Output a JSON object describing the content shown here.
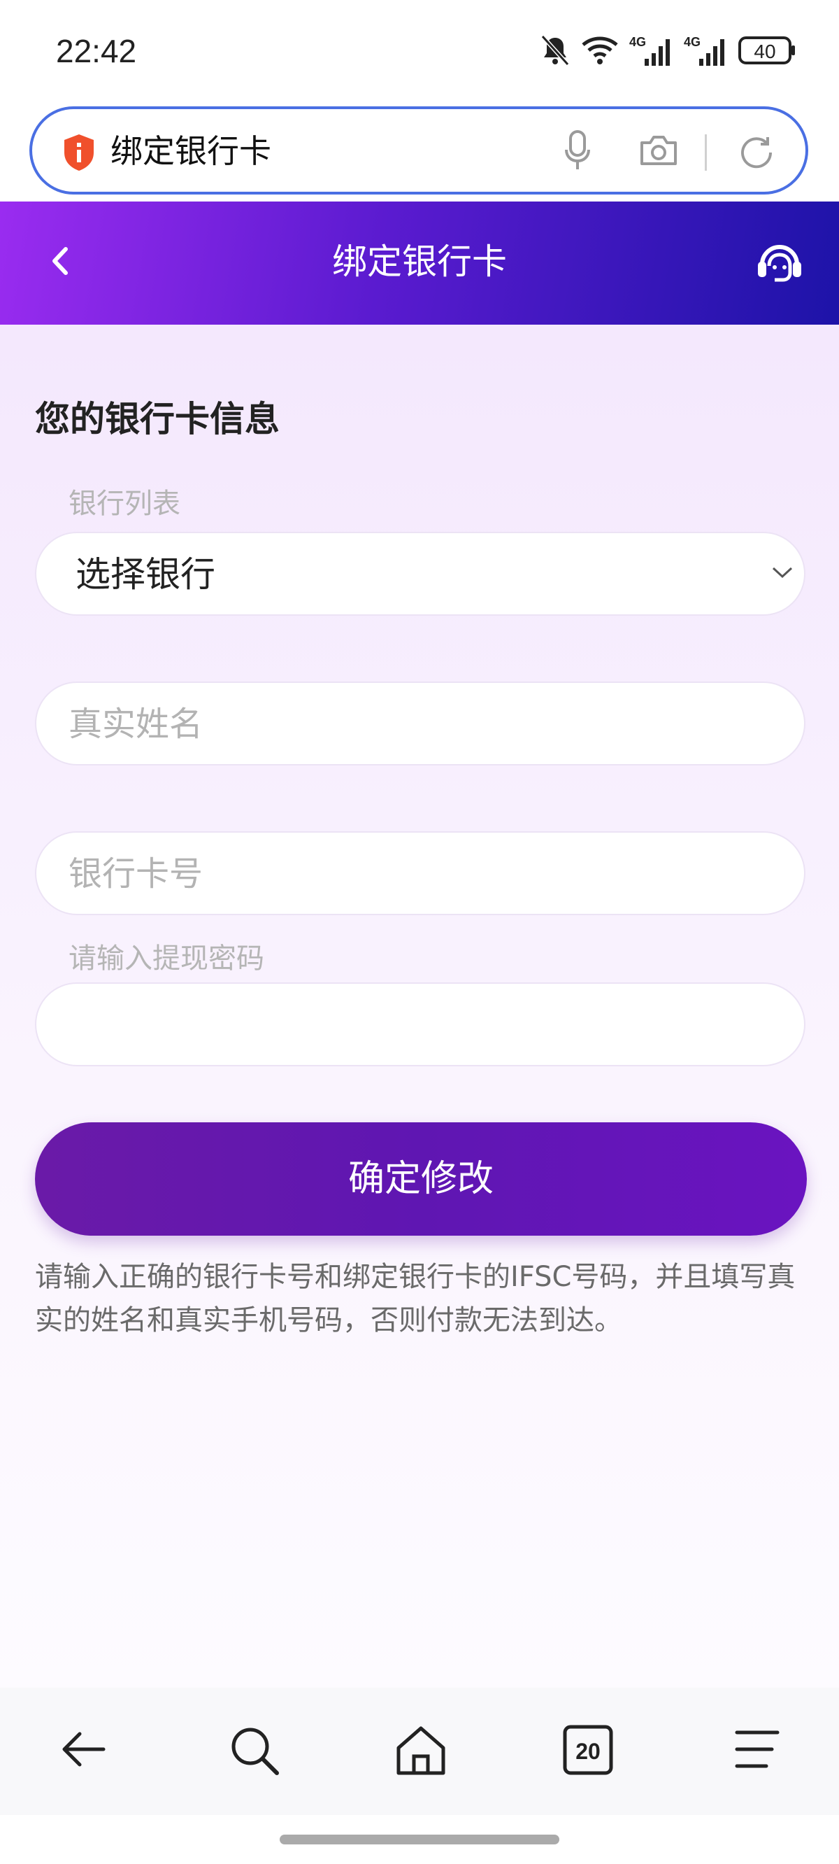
{
  "status_bar": {
    "time": "22:42",
    "network_1": "4G",
    "network_2": "4G",
    "battery": "40"
  },
  "browser": {
    "address_text": "绑定银行卡",
    "icons": [
      "shield-icon",
      "microphone-icon",
      "camera-icon",
      "reload-icon"
    ]
  },
  "header": {
    "title": "绑定银行卡",
    "icons": [
      "back-icon",
      "customer-service-icon"
    ]
  },
  "form": {
    "section_title": "您的银行卡信息",
    "bank_list_label": "银行列表",
    "bank_select_value": "选择银行",
    "real_name_placeholder": "真实姓名",
    "card_number_placeholder": "银行卡号",
    "password_label": "请输入提现密码",
    "submit_label": "确定修改",
    "notice": "请输入正确的银行卡号和绑定银行卡的IFSC号码，并且填写真实的姓名和真实手机号码，否则付款无法到达。"
  },
  "bottom_nav": {
    "tabs_count": "20",
    "icons": [
      "back-arrow-icon",
      "search-icon",
      "home-icon",
      "tabs-icon",
      "menu-icon"
    ]
  },
  "colors": {
    "header_gradient_start": "#9a2cf0",
    "header_gradient_end": "#1d13a8",
    "button": "#6418b0",
    "browser_border": "#4a6fe3"
  }
}
